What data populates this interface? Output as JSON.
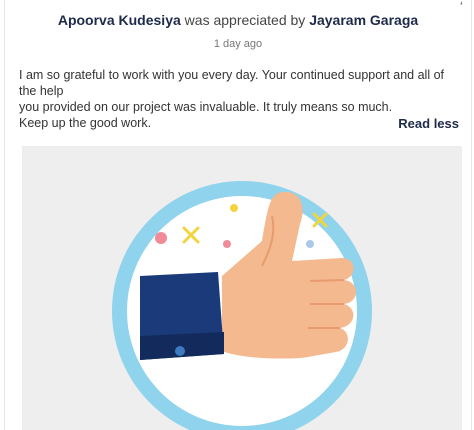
{
  "post": {
    "giver": "Apoorva Kudesiya",
    "action": " was appreciated by ",
    "receiver": "Jayaram Garaga",
    "timestamp": "1 day ago",
    "message_lines": [
      "I am so grateful to work with you every day. Your continued support and all of the help",
      "you provided on our project was invaluable. It truly means so much.",
      "Keep up the good work."
    ],
    "read_less_label": "Read less"
  },
  "colors": {
    "name": "#1e2a4a",
    "ring": "#8fd3ec",
    "sleeve": "#1a3a7a",
    "hand": "#f5b98f",
    "panel": "#eeeeee"
  },
  "image": {
    "icon": "thumbs-up-icon"
  }
}
